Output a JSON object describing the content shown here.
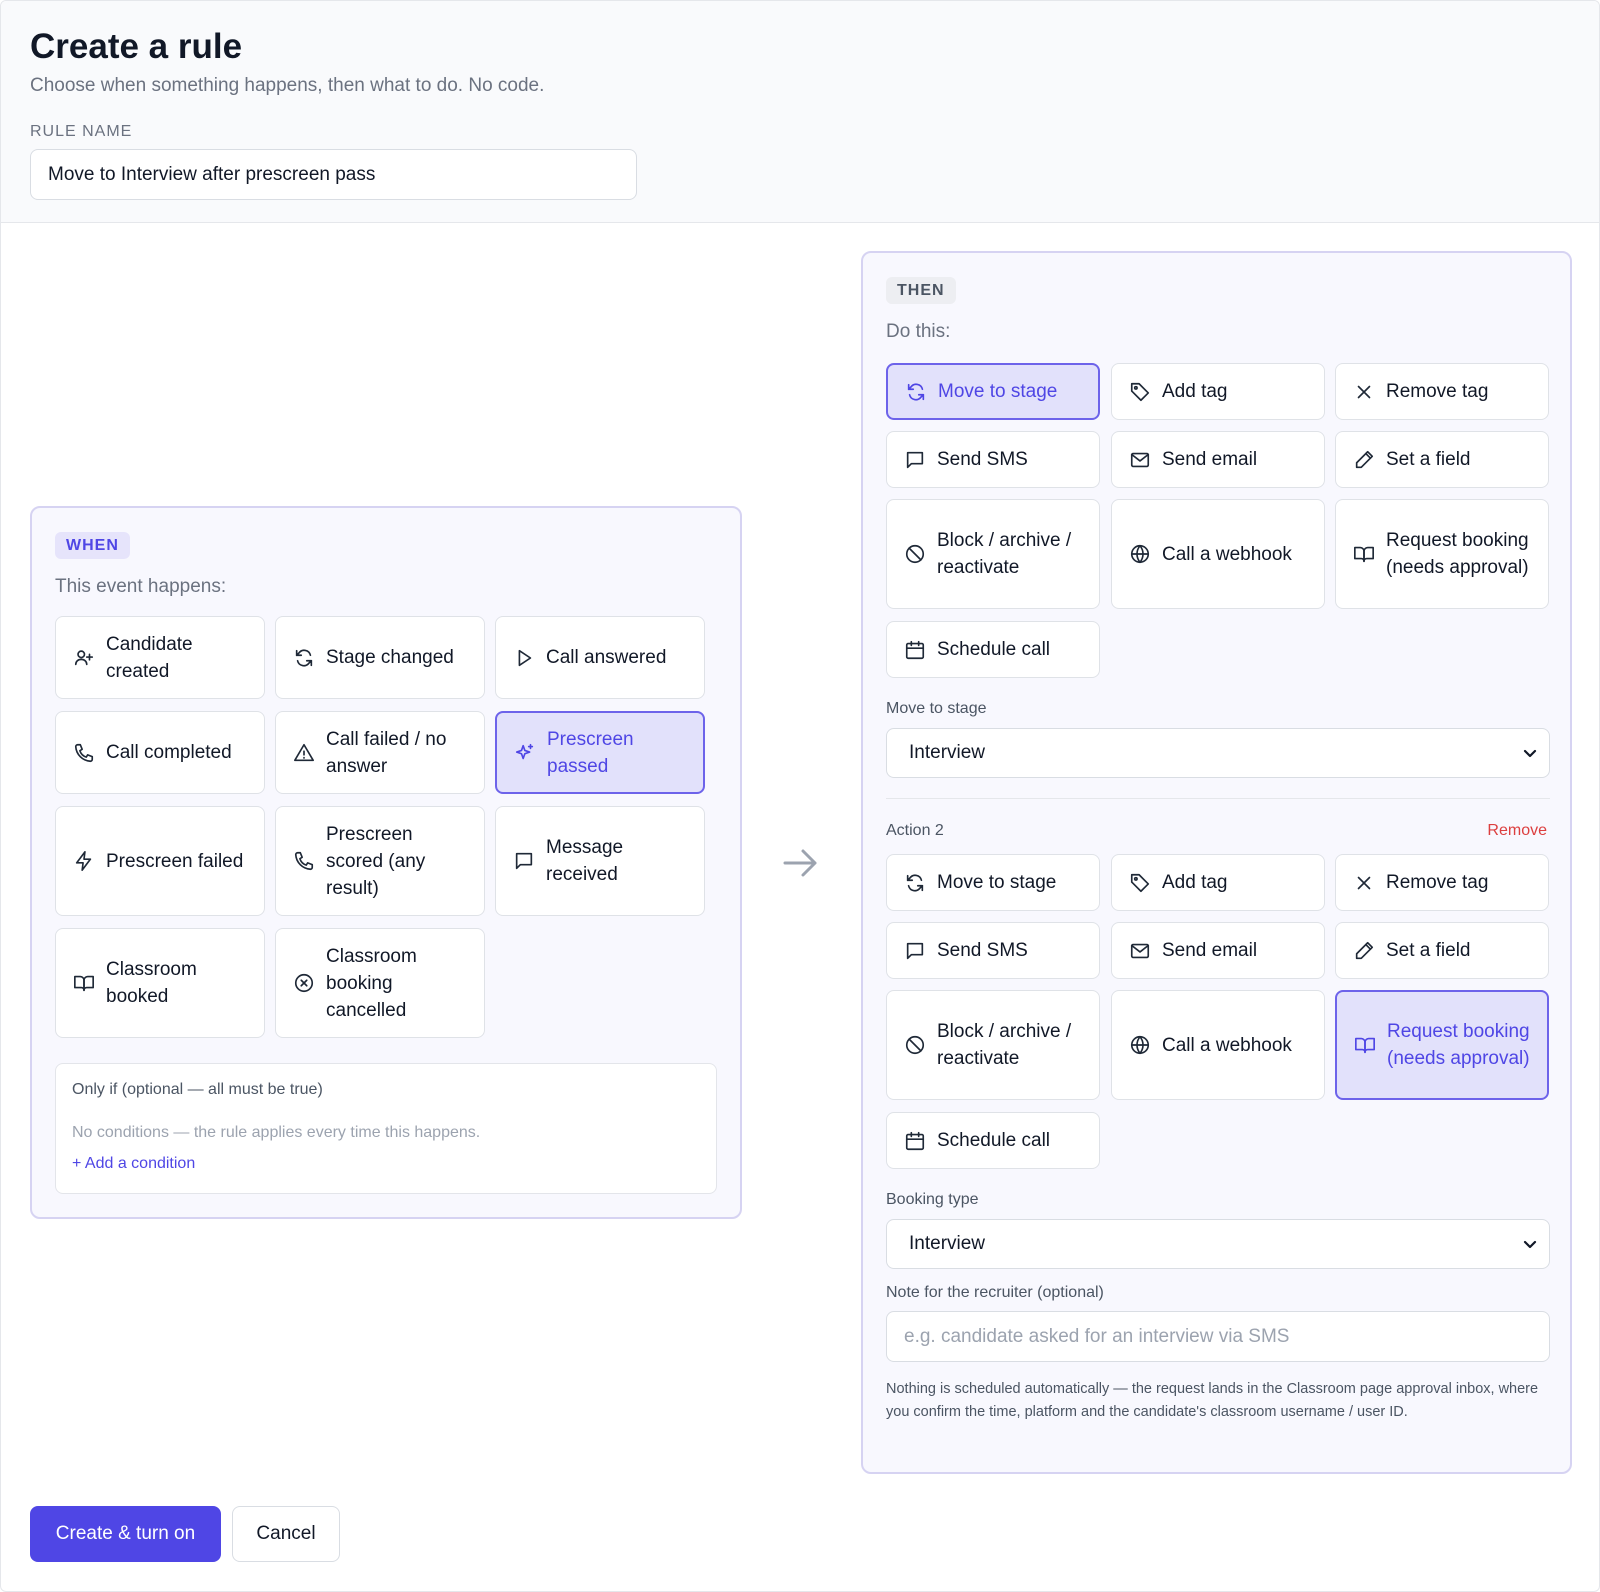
{
  "header": {
    "title": "Create a rule",
    "subtitle": "Choose when something happens, then what to do. No code.",
    "rule_name_label": "RULE NAME",
    "rule_name_value": "Move to Interview after prescreen pass"
  },
  "when": {
    "badge": "WHEN",
    "subtitle": "This event happens:",
    "events": [
      {
        "label": "Candidate created",
        "icon": "user-plus-icon"
      },
      {
        "label": "Stage changed",
        "icon": "refresh-icon"
      },
      {
        "label": "Call answered",
        "icon": "play-icon"
      },
      {
        "label": "Call completed",
        "icon": "phone-icon"
      },
      {
        "label": "Call failed / no answer",
        "icon": "warning-icon"
      },
      {
        "label": "Prescreen passed",
        "icon": "sparkles-icon",
        "selected": true
      },
      {
        "label": "Prescreen failed",
        "icon": "bolt-icon"
      },
      {
        "label": "Prescreen scored (any result)",
        "icon": "phone-icon"
      },
      {
        "label": "Message received",
        "icon": "message-icon"
      },
      {
        "label": "Classroom booked",
        "icon": "book-icon"
      },
      {
        "label": "Classroom booking cancelled",
        "icon": "circle-x-icon"
      }
    ],
    "conditions": {
      "title": "Only if (optional — all must be true)",
      "empty_text": "No conditions — the rule applies every time this happens.",
      "add_label": "+ Add a condition"
    }
  },
  "then": {
    "badge": "THEN",
    "subtitle": "Do this:",
    "action1": {
      "options": [
        {
          "label": "Move to stage",
          "icon": "refresh-icon",
          "selected": true
        },
        {
          "label": "Add tag",
          "icon": "tag-icon"
        },
        {
          "label": "Remove tag",
          "icon": "x-icon"
        },
        {
          "label": "Send SMS",
          "icon": "message-icon"
        },
        {
          "label": "Send email",
          "icon": "mail-icon"
        },
        {
          "label": "Set a field",
          "icon": "pencil-icon"
        },
        {
          "label": "Block / archive / reactivate",
          "icon": "ban-icon"
        },
        {
          "label": "Call a webhook",
          "icon": "globe-icon"
        },
        {
          "label": "Request booking (needs approval)",
          "icon": "book-icon"
        },
        {
          "label": "Schedule call",
          "icon": "calendar-icon"
        }
      ],
      "field_label": "Move to stage",
      "field_value": "Interview"
    },
    "action2": {
      "title": "Action 2",
      "remove_label": "Remove",
      "options": [
        {
          "label": "Move to stage",
          "icon": "refresh-icon"
        },
        {
          "label": "Add tag",
          "icon": "tag-icon"
        },
        {
          "label": "Remove tag",
          "icon": "x-icon"
        },
        {
          "label": "Send SMS",
          "icon": "message-icon"
        },
        {
          "label": "Send email",
          "icon": "mail-icon"
        },
        {
          "label": "Set a field",
          "icon": "pencil-icon"
        },
        {
          "label": "Block / archive / reactivate",
          "icon": "ban-icon"
        },
        {
          "label": "Call a webhook",
          "icon": "globe-icon"
        },
        {
          "label": "Request booking (needs approval)",
          "icon": "book-icon",
          "selected": true
        },
        {
          "label": "Schedule call",
          "icon": "calendar-icon"
        }
      ],
      "booking_label": "Booking type",
      "booking_value": "Interview",
      "note_label": "Note for the recruiter (optional)",
      "note_placeholder": "e.g. candidate asked for an interview via SMS",
      "note_value": "",
      "help_text": "Nothing is scheduled automatically — the request lands in the Classroom page approval inbox, where you confirm the time, platform and the candidate's classroom username / user ID."
    }
  },
  "footer": {
    "primary_label": "Create & turn on",
    "cancel_label": "Cancel"
  },
  "colors": {
    "accent": "#4f46e5",
    "selected_bg": "#e2e1fb",
    "danger": "#dc3f3f"
  }
}
